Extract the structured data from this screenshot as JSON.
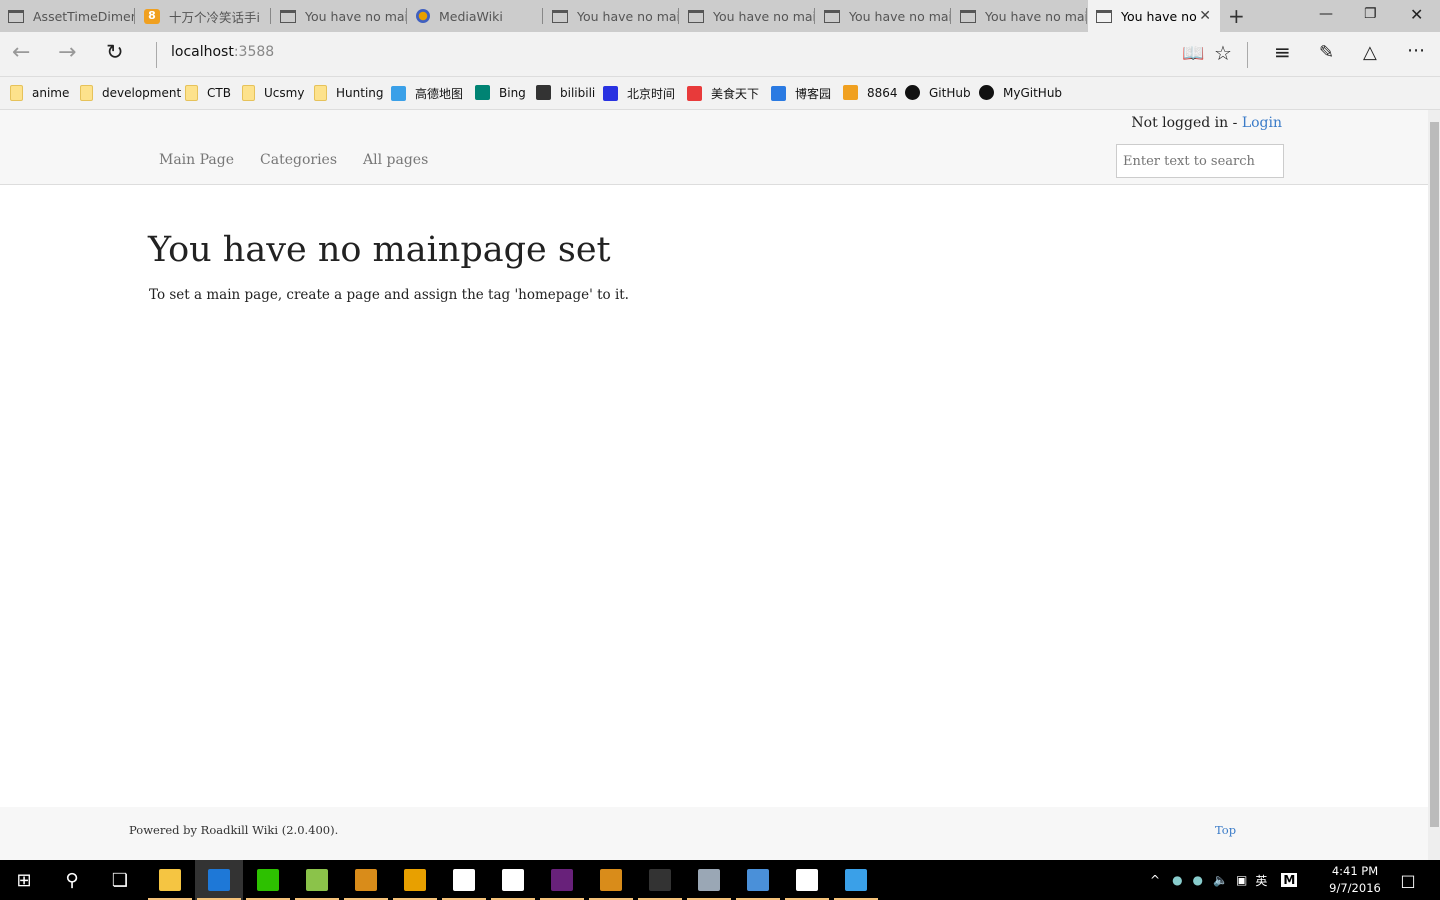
{
  "browser": {
    "tabs": [
      {
        "title": "AssetTimeDimer",
        "icon": "page"
      },
      {
        "title": "十万个冷笑话手i",
        "icon": "8864"
      },
      {
        "title": "You have no mai",
        "icon": "page"
      },
      {
        "title": "MediaWiki",
        "icon": "mediawiki"
      },
      {
        "title": "You have no mai",
        "icon": "page"
      },
      {
        "title": "You have no mai",
        "icon": "page"
      },
      {
        "title": "You have no mai",
        "icon": "page"
      },
      {
        "title": "You have no mai",
        "icon": "page"
      },
      {
        "title": "You have no",
        "icon": "page",
        "active": true
      }
    ],
    "new_tab": "+",
    "address_host": "localhost",
    "address_port": ":3588",
    "bookmarks": [
      {
        "label": "anime",
        "icon": "folder"
      },
      {
        "label": "development",
        "icon": "folder"
      },
      {
        "label": "CTB",
        "icon": "folder"
      },
      {
        "label": "Ucsmy",
        "icon": "folder"
      },
      {
        "label": "Hunting",
        "icon": "folder"
      },
      {
        "label": "高德地图",
        "icon": "amap",
        "color": "#3aa0e8"
      },
      {
        "label": "Bing",
        "icon": "bing",
        "color": "#008373"
      },
      {
        "label": "bilibili",
        "icon": "bilibili",
        "color": "#333333"
      },
      {
        "label": "北京时间",
        "icon": "baidu",
        "color": "#2932e1"
      },
      {
        "label": "美食天下",
        "icon": "meishi",
        "color": "#e83a3a"
      },
      {
        "label": "博客园",
        "icon": "cnblogs",
        "color": "#2a7ae2"
      },
      {
        "label": "8864",
        "icon": "8864",
        "color": "#f0a020"
      },
      {
        "label": "GitHub",
        "icon": "github",
        "color": "#111111"
      },
      {
        "label": "MyGitHub",
        "icon": "github",
        "color": "#111111"
      }
    ]
  },
  "wiki": {
    "login_status": "Not logged in - ",
    "login_link": "Login",
    "nav": [
      "Main Page",
      "Categories",
      "All pages"
    ],
    "search_placeholder": "Enter text to search",
    "title": "You have no mainpage set",
    "description": "To set a main page, create a page and assign the tag 'homepage' to it.",
    "footer": "Powered by Roadkill Wiki (2.0.400).",
    "top_link": "Top"
  },
  "taskbar": {
    "apps": [
      {
        "name": "file-explorer",
        "color": "#f5c542",
        "run": true
      },
      {
        "name": "edge",
        "color": "#1e78d7",
        "run": true,
        "active": true
      },
      {
        "name": "wechat",
        "color": "#2dc100",
        "run": true
      },
      {
        "name": "notepad-plus",
        "color": "#8bc34a",
        "run": true
      },
      {
        "name": "app-orange",
        "color": "#d98c1a",
        "run": true
      },
      {
        "name": "search-tool",
        "color": "#e8a000",
        "run": true
      },
      {
        "name": "store",
        "color": "#ffffff",
        "run": true
      },
      {
        "name": "mail",
        "color": "#ffffff",
        "run": true
      },
      {
        "name": "visual-studio",
        "color": "#68217a",
        "run": true
      },
      {
        "name": "app-video",
        "color": "#d98c1a",
        "run": true
      },
      {
        "name": "terminal",
        "color": "#333333",
        "run": true
      },
      {
        "name": "remote",
        "color": "#9aa7b5",
        "run": true
      },
      {
        "name": "sublime",
        "color": "#4a90d9",
        "run": true
      },
      {
        "name": "calculator",
        "color": "#ffffff",
        "run": true
      },
      {
        "name": "baidu-cloud",
        "color": "#3aa0e8",
        "run": true
      }
    ],
    "ime": "英",
    "time": "4:41 PM",
    "date": "9/7/2016"
  }
}
